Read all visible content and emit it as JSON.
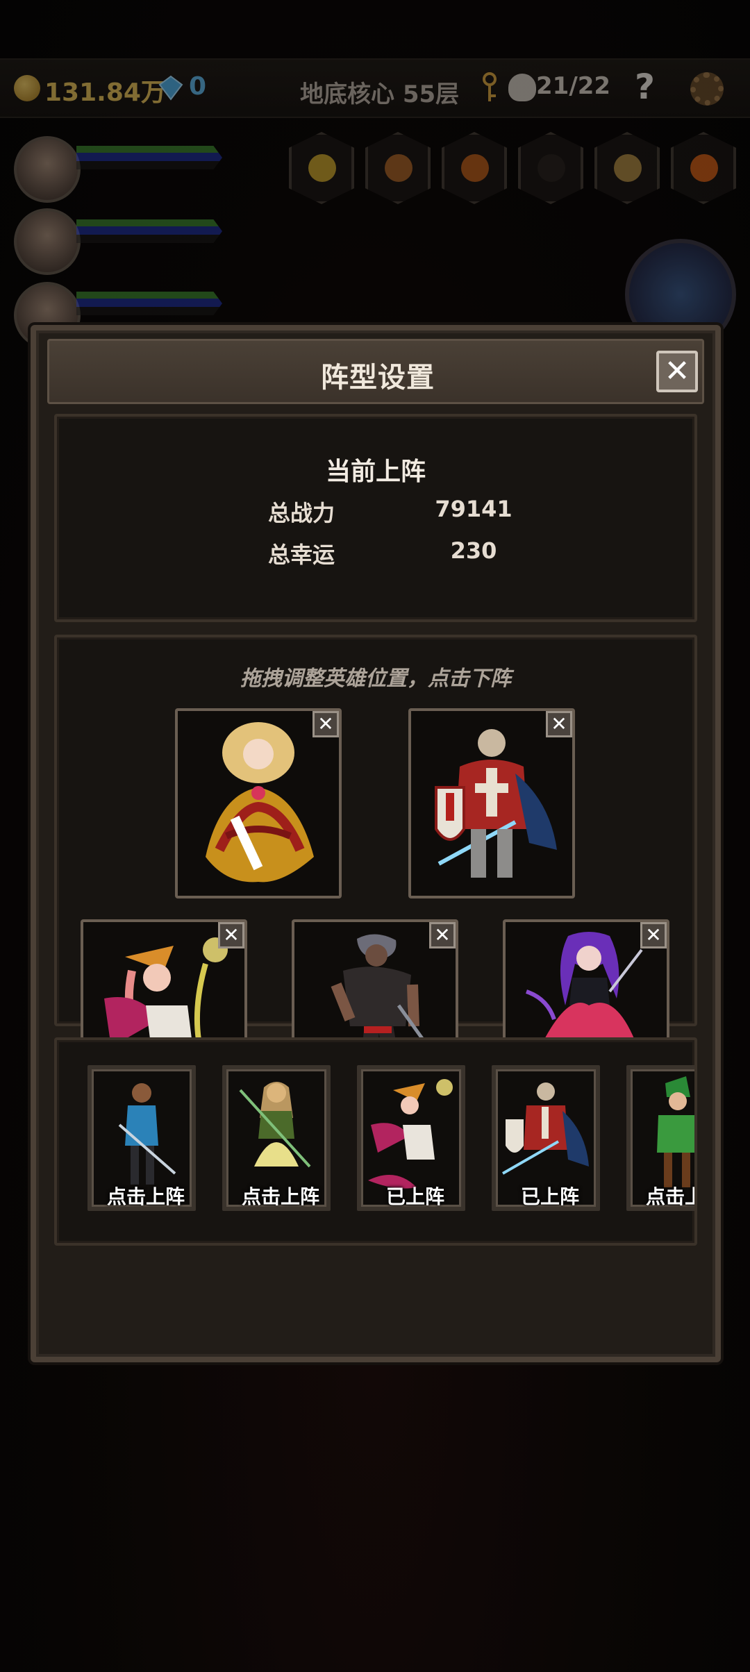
{
  "topbar": {
    "gold": "131.84万",
    "gems": "0",
    "floor": "地底核心 55层",
    "kills": "21/22",
    "help_label": "?"
  },
  "modal": {
    "title": "阵型设置",
    "close_label": "✕",
    "current_title": "当前上阵",
    "power_label": "总战力",
    "power_value": "79141",
    "luck_label": "总幸运",
    "luck_value": "230",
    "hint": "拖拽调整英雄位置，点击下阵",
    "remove_label": "✕"
  },
  "roster": [
    {
      "status": "点击上阵"
    },
    {
      "status": "点击上阵"
    },
    {
      "status": "已上阵"
    },
    {
      "status": "已上阵"
    },
    {
      "status": "点击上阵"
    }
  ],
  "colors": {
    "gold_text": "#e7c25b",
    "gem_text": "#5fb7e8",
    "panel_bg": "#171411",
    "frame": "#4b4036"
  }
}
